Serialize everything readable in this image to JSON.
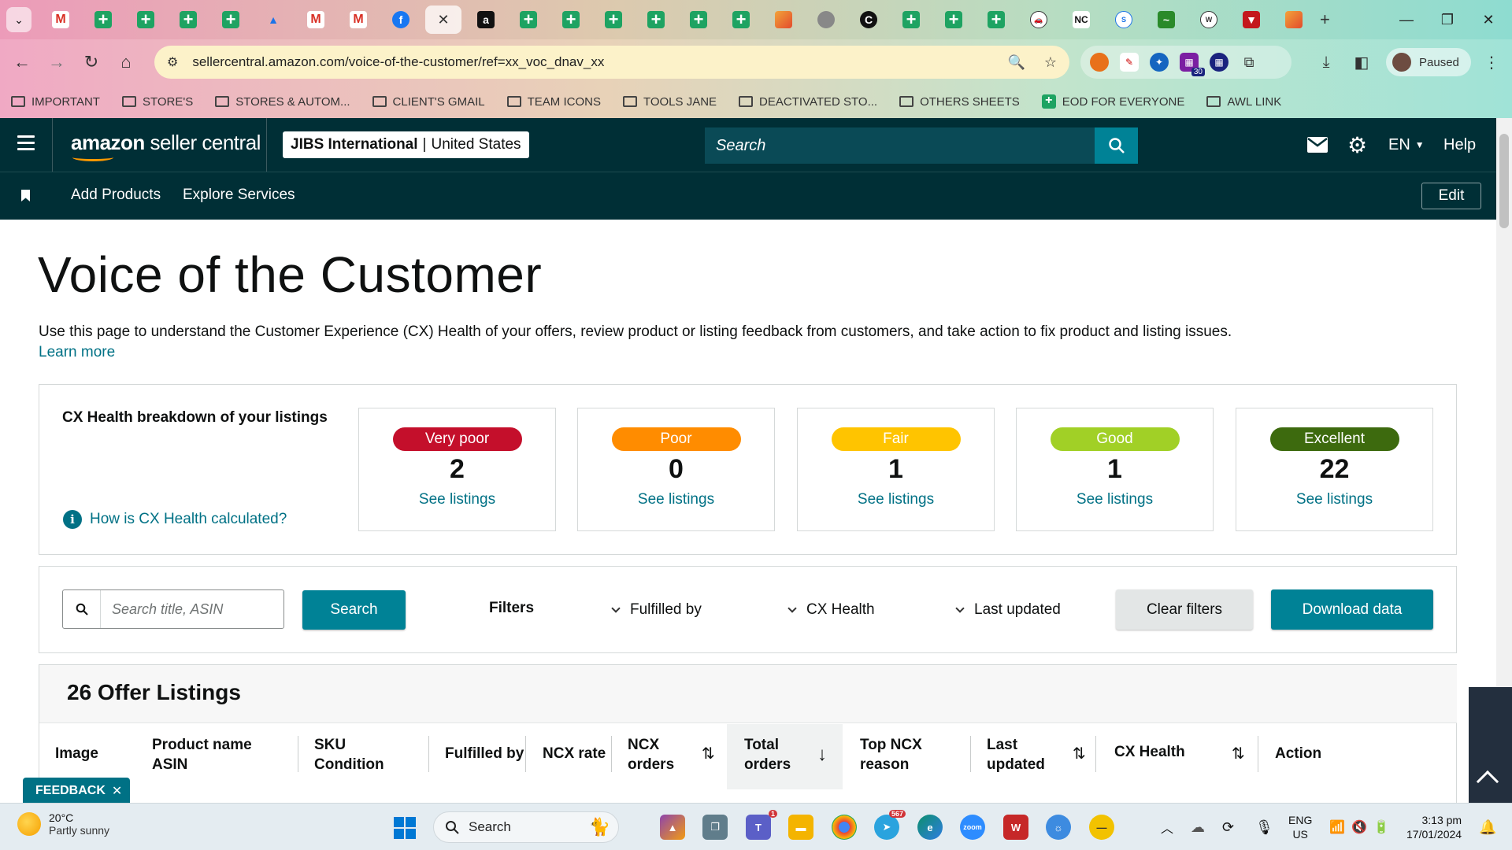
{
  "browser": {
    "url": "sellercentral.amazon.com/voice-of-the-customer/ref=xx_voc_dnav_xx",
    "profile_status": "Paused",
    "calendar_badge": "30",
    "extension_nc": "NC",
    "bookmarks": [
      {
        "label": "IMPORTANT",
        "icon": "folder-icon"
      },
      {
        "label": "STORE'S",
        "icon": "folder-icon"
      },
      {
        "label": "STORES & AUTOM...",
        "icon": "folder-icon"
      },
      {
        "label": "CLIENT'S GMAIL",
        "icon": "folder-icon"
      },
      {
        "label": "TEAM ICONS",
        "icon": "folder-icon"
      },
      {
        "label": "TOOLS JANE",
        "icon": "folder-icon"
      },
      {
        "label": "DEACTIVATED STO...",
        "icon": "folder-icon"
      },
      {
        "label": "OTHERS SHEETS",
        "icon": "folder-icon"
      },
      {
        "label": "EOD FOR EVERYONE",
        "icon": "sheets-icon"
      },
      {
        "label": "AWL LINK",
        "icon": "folder-icon"
      }
    ]
  },
  "header": {
    "logo_bold": "amazon",
    "logo_rest": " seller central",
    "store_name": "JIBS International",
    "store_region": "United States",
    "search_placeholder": "Search",
    "language": "EN",
    "help": "Help",
    "nav": {
      "add_products": "Add Products",
      "explore_services": "Explore Services",
      "edit": "Edit"
    }
  },
  "page": {
    "title": "Voice of the Customer",
    "description": "Use this page to understand the Customer Experience (CX) Health of your offers, review product or listing feedback from customers, and take action to fix product and listing issues.",
    "learn_more": "Learn more"
  },
  "cx_health": {
    "title": "CX Health breakdown of your listings",
    "info_link": "How is CX Health calculated?",
    "categories": [
      {
        "label": "Very poor",
        "count": "2",
        "link": "See listings",
        "color": "#c40f2b"
      },
      {
        "label": "Poor",
        "count": "0",
        "link": "See listings",
        "color": "#ff8c00"
      },
      {
        "label": "Fair",
        "count": "1",
        "link": "See listings",
        "color": "#ffc400"
      },
      {
        "label": "Good",
        "count": "1",
        "link": "See listings",
        "color": "#a1d026"
      },
      {
        "label": "Excellent",
        "count": "22",
        "link": "See listings",
        "color": "#3d6a0e"
      }
    ]
  },
  "filters": {
    "search_placeholder": "Search title, ASIN",
    "search_button": "Search",
    "label": "Filters",
    "fulfilled_by": "Fulfilled by",
    "cx_health": "CX Health",
    "last_updated": "Last updated",
    "clear": "Clear filters",
    "download": "Download data"
  },
  "listings": {
    "title": "26 Offer Listings",
    "columns": {
      "image": "Image",
      "product_1": "Product name",
      "product_2": "ASIN",
      "sku_1": "SKU",
      "sku_2": "Condition",
      "fulfilled_by": "Fulfilled by",
      "ncx_rate": "NCX rate",
      "ncx_orders_1": "NCX",
      "ncx_orders_2": "orders",
      "total_orders_1": "Total",
      "total_orders_2": "orders",
      "top_ncx_1": "Top NCX",
      "top_ncx_2": "reason",
      "last_updated_1": "Last",
      "last_updated_2": "updated",
      "cx_health": "CX Health",
      "action": "Action"
    }
  },
  "feedback": "FEEDBACK",
  "taskbar": {
    "temperature": "20°C",
    "weather": "Partly sunny",
    "search": "Search",
    "telegram_badge": "567",
    "teams_badge": "1",
    "language": "ENG",
    "region": "US",
    "time": "3:13 pm",
    "date": "17/01/2024"
  }
}
